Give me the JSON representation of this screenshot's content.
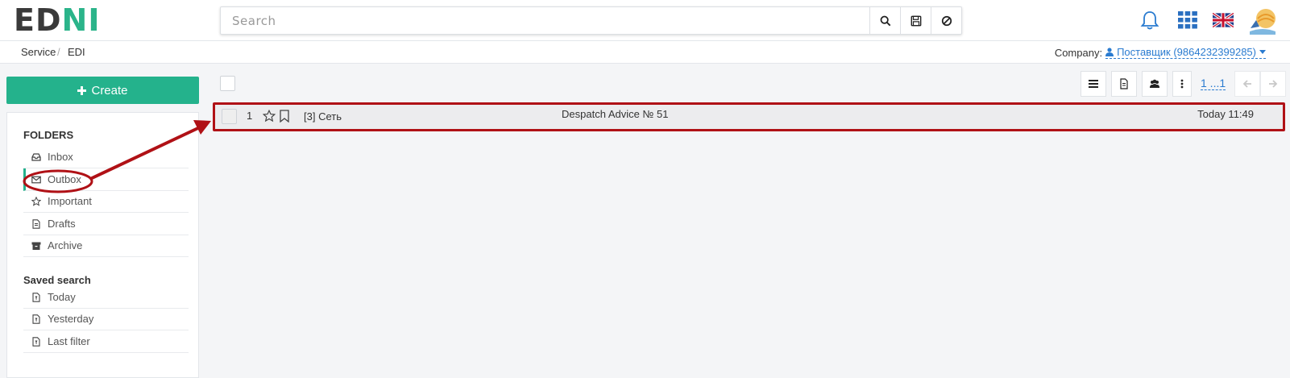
{
  "header": {
    "logo_part1": "ED",
    "logo_part2": "NI",
    "search_placeholder": "Search"
  },
  "breadcrumb": {
    "items": [
      "Service",
      "EDI"
    ],
    "separator": "/"
  },
  "company": {
    "label": "Company:",
    "value": "Поставщик (9864232399285)"
  },
  "sidebar": {
    "create_label": "Create",
    "folders_title": "FOLDERS",
    "folders": [
      {
        "label": "Inbox",
        "icon": "inbox-icon"
      },
      {
        "label": "Outbox",
        "icon": "envelope-icon",
        "active": true
      },
      {
        "label": "Important",
        "icon": "star-icon"
      },
      {
        "label": "Drafts",
        "icon": "file-icon"
      },
      {
        "label": "Archive",
        "icon": "archive-icon"
      }
    ],
    "saved_title": "Saved search",
    "saved": [
      {
        "label": "Today",
        "icon": "filter-file-icon"
      },
      {
        "label": "Yesterday",
        "icon": "filter-file-icon"
      },
      {
        "label": "Last filter",
        "icon": "filter-file-icon"
      }
    ]
  },
  "toolbar": {
    "pager": "1 ...1"
  },
  "documents": [
    {
      "num": "1",
      "sender": "[3] Сеть",
      "subject": "Despatch Advice № 51",
      "date": "Today 11:49"
    }
  ],
  "colors": {
    "accent": "#24b28c",
    "link": "#2a7bd0",
    "highlight": "#b01116"
  }
}
